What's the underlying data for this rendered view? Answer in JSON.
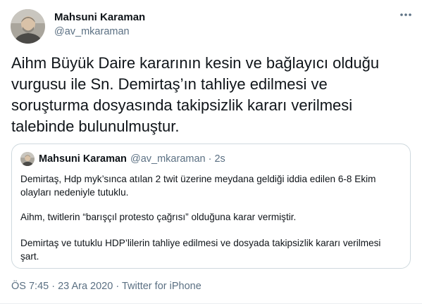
{
  "author": {
    "name": "Mahsuni Karaman",
    "handle": "@av_mkaraman"
  },
  "tweet": {
    "text": "Aihm Büyük Daire kararının kesin ve bağlayıcı olduğu\nvurgusu ile Sn. Demirtaş’ın tahliye edilmesi ve\nsoruşturma dosyasında takipsizlik kararı verilmesi\ntalebinde bulunulmuştur."
  },
  "quoted_tweet": {
    "name": "Mahsuni Karaman",
    "meta": "@av_mkaraman · 2s",
    "paragraphs": [
      "Demirtaş, Hdp myk’sınca atılan 2 twit üzerine meydana geldiği iddia edilen 6-8 Ekim olayları nedeniyle tutuklu.",
      "Aihm, twitlerin “barışçıl protesto çağrısı” olduğuna karar vermiştir.",
      "Demirtaş ve tutuklu HDP’lilerin tahliye edilmesi ve dosyada takipsizlik kararı verilmesi şart."
    ]
  },
  "footer": {
    "time": "ÖS 7:45",
    "date": "23 Ara 2020",
    "source": "Twitter for iPhone",
    "separator": " · "
  },
  "icons": {
    "more": "more-horizontal-icon",
    "avatar": "avatar-icon"
  },
  "colors": {
    "text": "#0f1419",
    "secondary": "#5b7083",
    "border": "#cfd9de"
  }
}
